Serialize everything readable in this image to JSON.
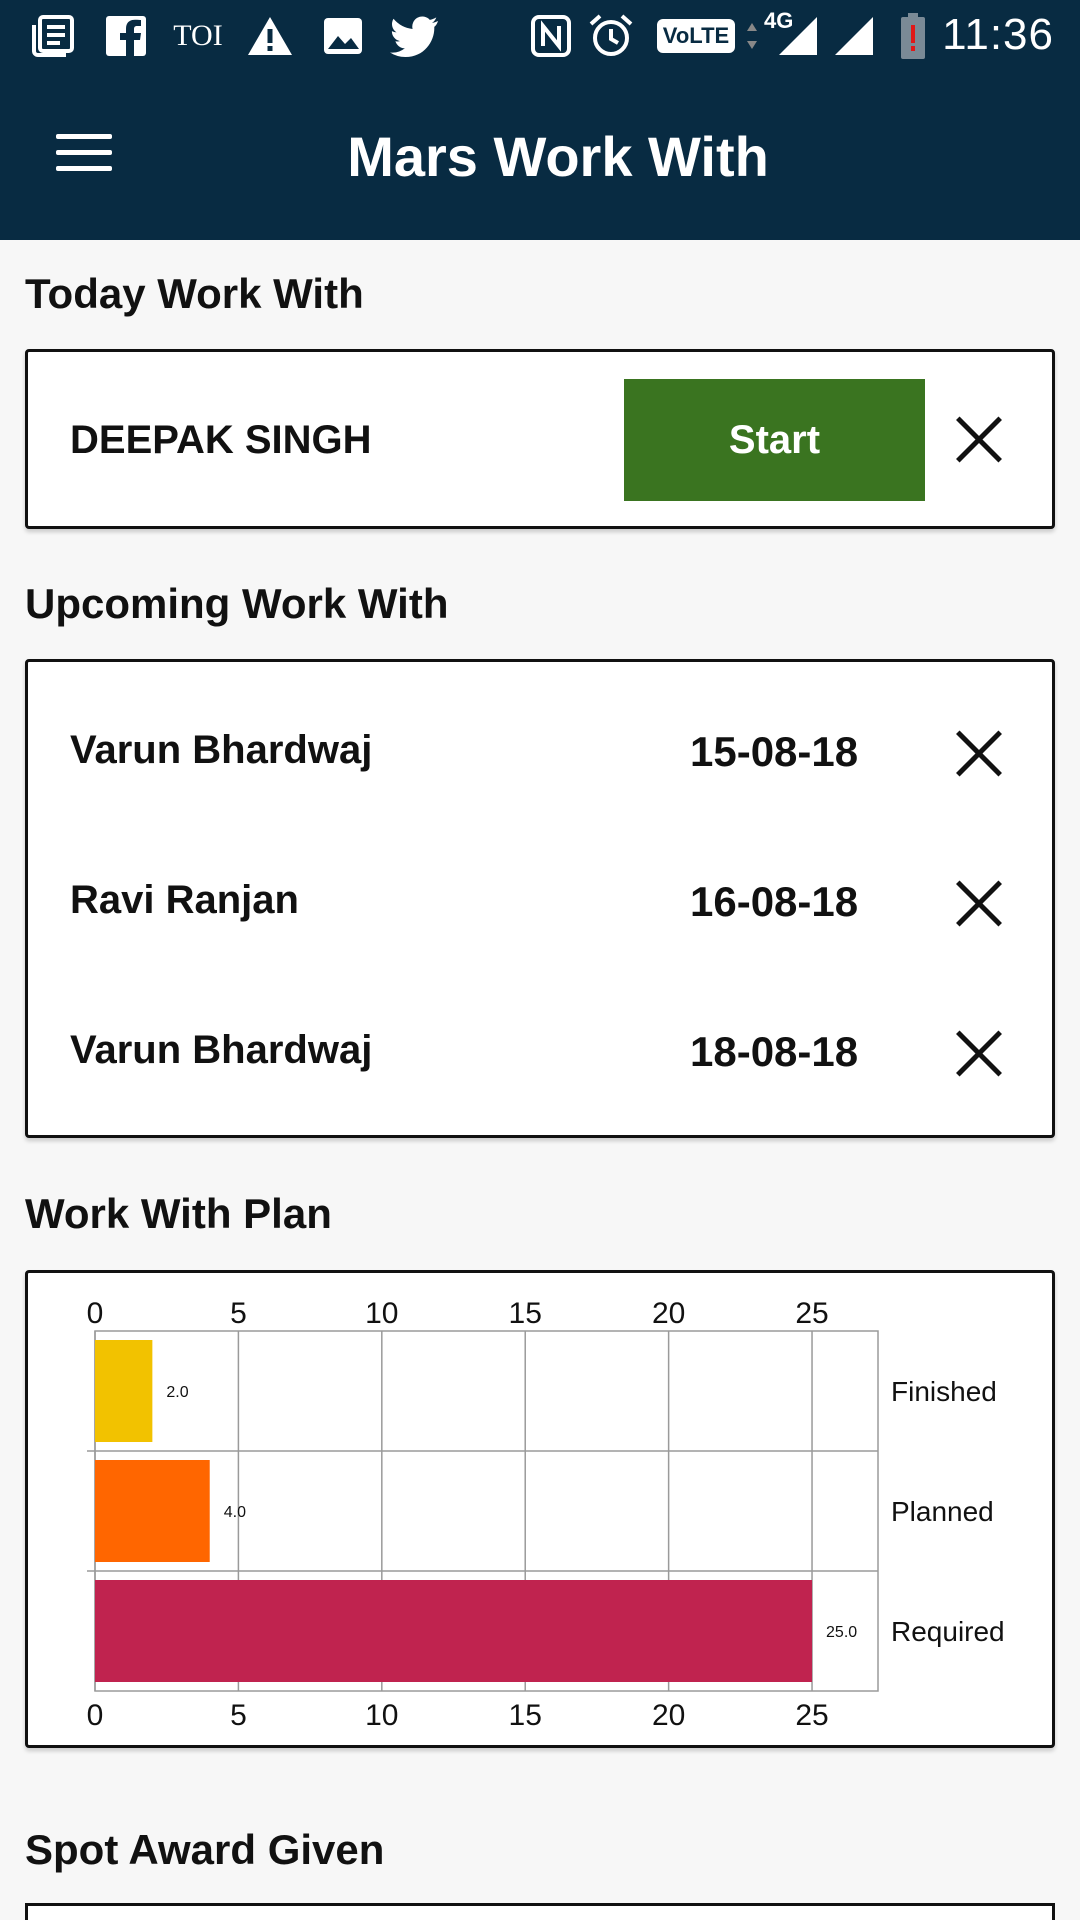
{
  "status_bar": {
    "time": "11:36",
    "network": "4G",
    "icons": [
      "news-icon",
      "facebook-icon",
      "toi-icon",
      "warning-icon",
      "image-icon",
      "twitter-icon",
      "nfc-icon",
      "alarm-icon",
      "volte-icon",
      "signal-icon",
      "signal-icon",
      "battery-low-icon"
    ],
    "toi_label": "TOI",
    "volte_label": "VoLTE"
  },
  "toolbar": {
    "title": "Mars Work With",
    "menu_icon": "hamburger-menu-icon"
  },
  "today": {
    "section_title": "Today Work With",
    "name": "DEEPAK SINGH",
    "start_label": "Start",
    "start_color": "#3a7420"
  },
  "upcoming": {
    "section_title": "Upcoming Work With",
    "items": [
      {
        "name": "Varun Bhardwaj",
        "date": "15-08-18"
      },
      {
        "name": "Ravi Ranjan",
        "date": "16-08-18"
      },
      {
        "name": "Varun Bhardwaj",
        "date": "18-08-18"
      }
    ]
  },
  "plan": {
    "section_title": "Work With Plan"
  },
  "spot_award": {
    "section_title": "Spot Award Given"
  },
  "chart_data": {
    "type": "bar",
    "orientation": "horizontal",
    "categories": [
      "Finished",
      "Planned",
      "Required"
    ],
    "values": [
      2.0,
      4.0,
      25.0
    ],
    "value_labels": [
      "2.0",
      "4.0",
      "25.0"
    ],
    "colors": [
      "#f2c200",
      "#ff6600",
      "#c0234f"
    ],
    "xlim": [
      0,
      27.3
    ],
    "ticks": [
      0,
      5,
      10,
      15,
      20,
      25
    ],
    "tick_labels": [
      "0",
      "5",
      "10",
      "15",
      "20",
      "25"
    ],
    "grid": true,
    "axis_labels_position": "top-and-bottom",
    "category_labels_position": "right"
  }
}
